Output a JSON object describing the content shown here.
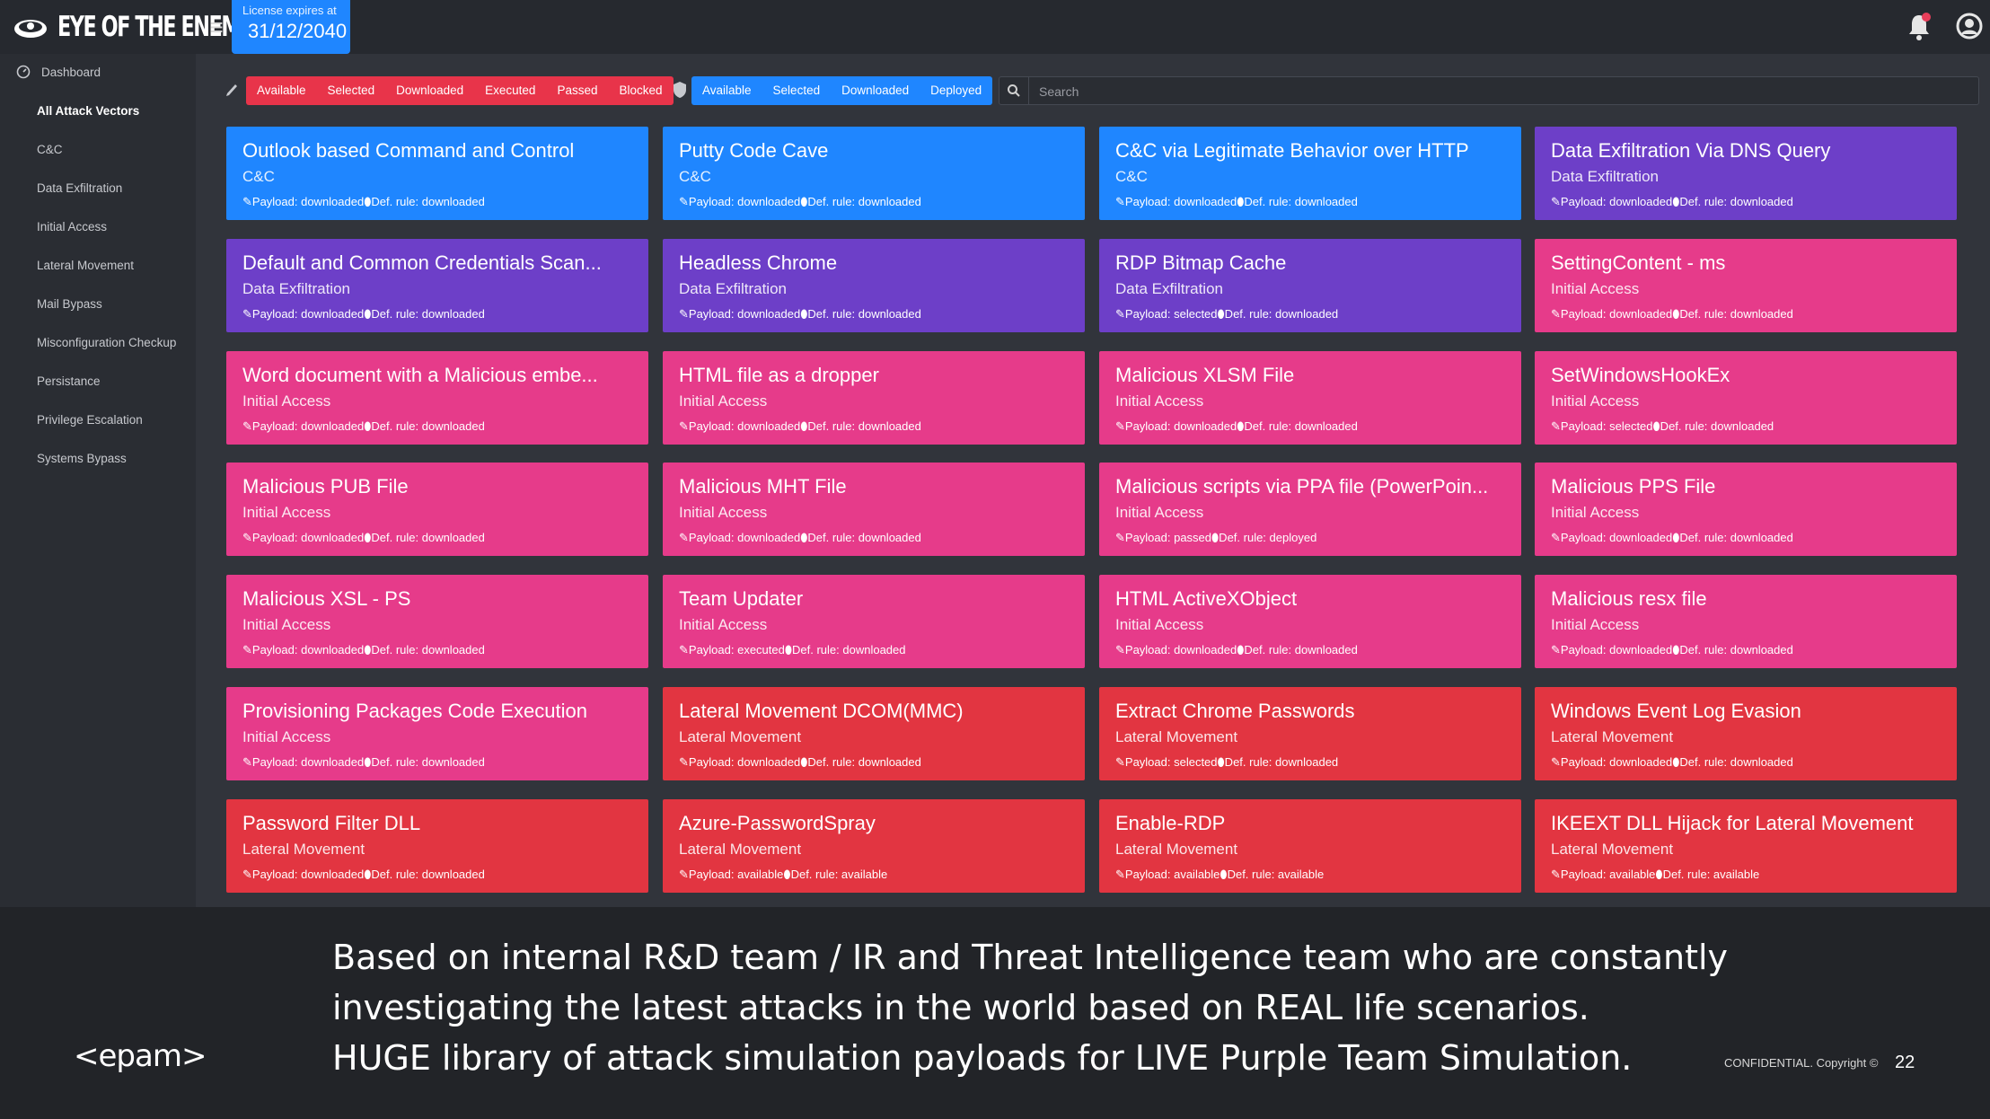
{
  "header": {
    "logo_text": "EYE OF THE ENEMY",
    "license_label": "License expires at",
    "license_date": "31/12/2040"
  },
  "sidebar": {
    "items": [
      {
        "label": "Dashboard"
      },
      {
        "label": "All Attack Vectors"
      },
      {
        "label": "C&C"
      },
      {
        "label": "Data Exfiltration"
      },
      {
        "label": "Initial Access"
      },
      {
        "label": "Lateral Movement"
      },
      {
        "label": "Mail Bypass"
      },
      {
        "label": "Misconfiguration Checkup"
      },
      {
        "label": "Persistance"
      },
      {
        "label": "Privilege Escalation"
      },
      {
        "label": "Systems Bypass"
      }
    ]
  },
  "filters": {
    "payload": [
      "Available",
      "Selected",
      "Downloaded",
      "Executed",
      "Passed",
      "Blocked"
    ],
    "defense": [
      "Available",
      "Selected",
      "Downloaded",
      "Deployed"
    ],
    "search_placeholder": "Search"
  },
  "colors": {
    "blue": "#1f86ff",
    "purple": "#6d3fc8",
    "pink": "#e63b8a",
    "red": "#e23541"
  },
  "cards": [
    {
      "title": "Outlook based Command and Control",
      "category": "C&C",
      "status": "✎Payload: downloaded⬮Def. rule: downloaded",
      "color": "blue"
    },
    {
      "title": "Putty Code Cave",
      "category": "C&C",
      "status": "✎Payload: downloaded⬮Def. rule: downloaded",
      "color": "blue"
    },
    {
      "title": "C&C via Legitimate Behavior over HTTP",
      "category": "C&C",
      "status": "✎Payload: downloaded⬮Def. rule: downloaded",
      "color": "blue"
    },
    {
      "title": "Data Exfiltration Via DNS Query",
      "category": "Data Exfiltration",
      "status": "✎Payload: downloaded⬮Def. rule: downloaded",
      "color": "purple"
    },
    {
      "title": "Default and Common Credentials Scan...",
      "category": "Data Exfiltration",
      "status": "✎Payload: downloaded⬮Def. rule: downloaded",
      "color": "purple"
    },
    {
      "title": "Headless Chrome",
      "category": "Data Exfiltration",
      "status": "✎Payload: downloaded⬮Def. rule: downloaded",
      "color": "purple"
    },
    {
      "title": "RDP Bitmap Cache",
      "category": "Data Exfiltration",
      "status": "✎Payload: selected⬮Def. rule: downloaded",
      "color": "purple"
    },
    {
      "title": "SettingContent - ms",
      "category": "Initial Access",
      "status": "✎Payload: downloaded⬮Def. rule: downloaded",
      "color": "pink"
    },
    {
      "title": "Word document with a Malicious embe...",
      "category": "Initial Access",
      "status": "✎Payload: downloaded⬮Def. rule: downloaded",
      "color": "pink"
    },
    {
      "title": "HTML file as a dropper",
      "category": "Initial Access",
      "status": "✎Payload: downloaded⬮Def. rule: downloaded",
      "color": "pink"
    },
    {
      "title": "Malicious XLSM File",
      "category": "Initial Access",
      "status": "✎Payload: downloaded⬮Def. rule: downloaded",
      "color": "pink"
    },
    {
      "title": "SetWindowsHookEx",
      "category": "Initial Access",
      "status": "✎Payload: selected⬮Def. rule: downloaded",
      "color": "pink"
    },
    {
      "title": "Malicious PUB File",
      "category": "Initial Access",
      "status": "✎Payload: downloaded⬮Def. rule: downloaded",
      "color": "pink"
    },
    {
      "title": "Malicious MHT File",
      "category": "Initial Access",
      "status": "✎Payload: downloaded⬮Def. rule: downloaded",
      "color": "pink"
    },
    {
      "title": "Malicious scripts via PPA file (PowerPoin...",
      "category": "Initial Access",
      "status": "✎Payload: passed⬮Def. rule: deployed",
      "color": "pink"
    },
    {
      "title": "Malicious PPS File",
      "category": "Initial Access",
      "status": "✎Payload: downloaded⬮Def. rule: downloaded",
      "color": "pink"
    },
    {
      "title": "Malicious XSL - PS",
      "category": "Initial Access",
      "status": "✎Payload: downloaded⬮Def. rule: downloaded",
      "color": "pink"
    },
    {
      "title": "Team Updater",
      "category": "Initial Access",
      "status": "✎Payload: executed⬮Def. rule: downloaded",
      "color": "pink"
    },
    {
      "title": "HTML ActiveXObject",
      "category": "Initial Access",
      "status": "✎Payload: downloaded⬮Def. rule: downloaded",
      "color": "pink"
    },
    {
      "title": "Malicious resx file",
      "category": "Initial Access",
      "status": "✎Payload: downloaded⬮Def. rule: downloaded",
      "color": "pink"
    },
    {
      "title": "Provisioning Packages Code Execution",
      "category": "Initial Access",
      "status": "✎Payload: downloaded⬮Def. rule: downloaded",
      "color": "pink"
    },
    {
      "title": "Lateral Movement DCOM(MMC)",
      "category": "Lateral Movement",
      "status": "✎Payload: downloaded⬮Def. rule: downloaded",
      "color": "red"
    },
    {
      "title": "Extract Chrome Passwords",
      "category": "Lateral Movement",
      "status": "✎Payload: selected⬮Def. rule: downloaded",
      "color": "red"
    },
    {
      "title": "Windows Event Log Evasion",
      "category": "Lateral Movement",
      "status": "✎Payload: downloaded⬮Def. rule: downloaded",
      "color": "red"
    },
    {
      "title": "Password Filter DLL",
      "category": "Lateral Movement",
      "status": "✎Payload: downloaded⬮Def. rule: downloaded",
      "color": "red"
    },
    {
      "title": "Azure-PasswordSpray",
      "category": "Lateral Movement",
      "status": "✎Payload: available⬮Def. rule: available",
      "color": "red"
    },
    {
      "title": "Enable-RDP",
      "category": "Lateral Movement",
      "status": "✎Payload: available⬮Def. rule: available",
      "color": "red"
    },
    {
      "title": "IKEEXT DLL Hijack for Lateral Movement",
      "category": "Lateral Movement",
      "status": "✎Payload: available⬮Def. rule: available",
      "color": "red"
    }
  ],
  "caption": {
    "line1": "Based on internal R&D team / IR and Threat Intelligence team who are constantly",
    "line2": "investigating the latest attacks in the world based on REAL life scenarios.",
    "line3": "HUGE library of attack simulation payloads for LIVE Purple Team Simulation."
  },
  "footer": {
    "brand": "<epam>",
    "confidential": "CONFIDENTIAL. Copyright ©",
    "page_number": "22"
  }
}
